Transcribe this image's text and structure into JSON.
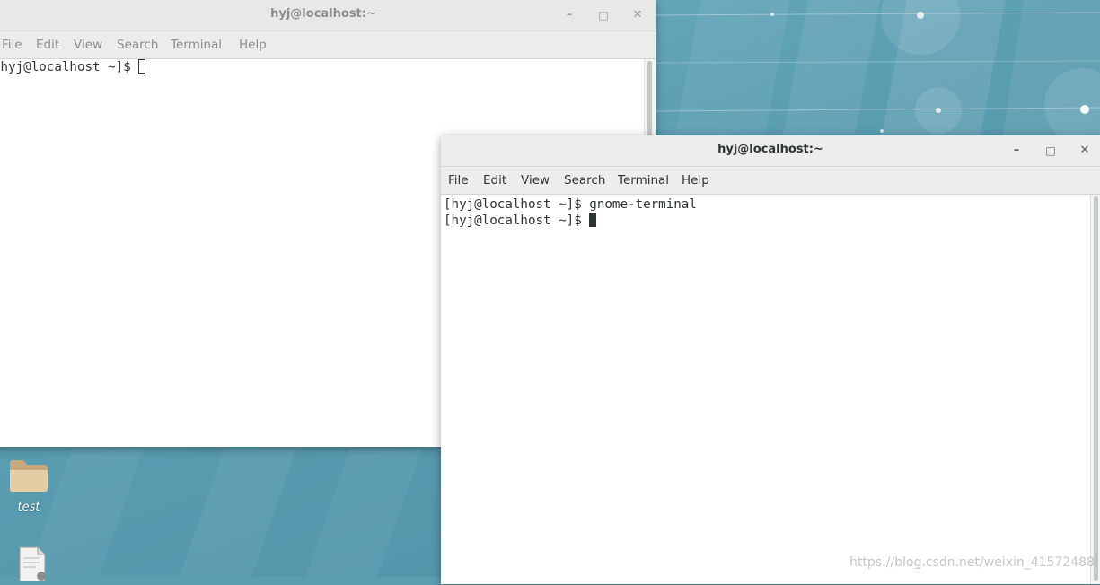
{
  "desktop": {
    "icons": [
      {
        "label": "test",
        "icon": "folder-icon"
      },
      {
        "label": "",
        "icon": "document-icon"
      }
    ]
  },
  "back_window": {
    "title": "hyj@localhost:~",
    "menu": [
      "File",
      "Edit",
      "View",
      "Search",
      "Terminal",
      "Help"
    ],
    "lines": [
      "[hyj@localhost ~]$ "
    ]
  },
  "front_window": {
    "title": "hyj@localhost:~",
    "menu": [
      "File",
      "Edit",
      "View",
      "Search",
      "Terminal",
      "Help"
    ],
    "lines": [
      "[hyj@localhost ~]$ gnome-terminal",
      "[hyj@localhost ~]$ "
    ]
  },
  "window_controls": {
    "minimize": "–",
    "maximize": "□",
    "close": "✕"
  },
  "watermark": "https://blog.csdn.net/weixin_41572488",
  "colors": {
    "desktop_accent": "#5d9db0",
    "titlebar": "#ededec",
    "terminal_bg": "#ffffff",
    "terminal_fg": "#2e3436"
  }
}
